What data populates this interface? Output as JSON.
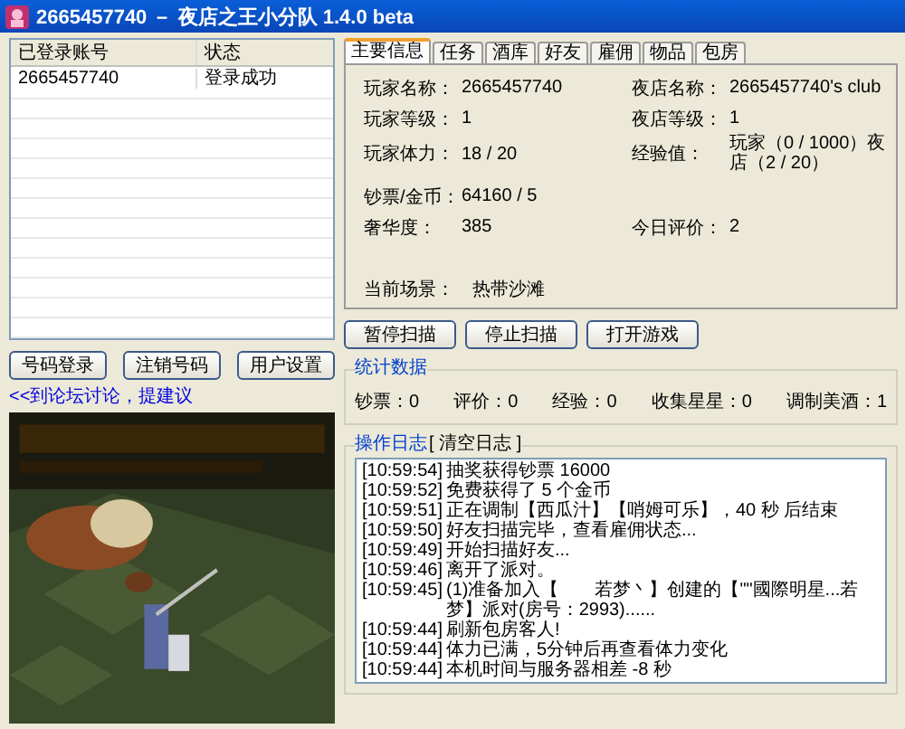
{
  "window": {
    "title": "2665457740 － 夜店之王小分队 1.4.0 beta"
  },
  "accounts": {
    "columns": [
      "已登录账号",
      "状态"
    ],
    "rows": [
      [
        "2665457740",
        "登录成功"
      ]
    ]
  },
  "left_buttons": [
    "号码登录",
    "注销号码",
    "用户设置"
  ],
  "forum_link": "<<到论坛讨论，提建议",
  "tabs": [
    {
      "label": "主要信息",
      "selected": true
    },
    {
      "label": "任务",
      "selected": false
    },
    {
      "label": "酒库",
      "selected": false
    },
    {
      "label": "好友",
      "selected": false
    },
    {
      "label": "雇佣",
      "selected": false
    },
    {
      "label": "物品",
      "selected": false
    },
    {
      "label": "包房",
      "selected": false
    }
  ],
  "info": [
    {
      "label": "玩家名称：",
      "value": "2665457740",
      "label2": "夜店名称：",
      "value2": "2665457740's club"
    },
    {
      "label": "玩家等级：",
      "value": "1",
      "label2": "夜店等级：",
      "value2": "1"
    },
    {
      "label": "玩家体力：",
      "value": "18 / 20",
      "label2": "经验值：",
      "value2": "玩家（0 / 1000）夜店（2 / 20）"
    },
    {
      "label": "钞票/金币：",
      "value": "64160 / 5"
    },
    {
      "label": "奢华度：",
      "value": "385",
      "label2": "今日评价：",
      "value2": "2"
    }
  ],
  "scene": {
    "label": "当前场景：",
    "value": "热带沙滩"
  },
  "right_buttons": [
    "暂停扫描",
    "停止扫描",
    "打开游戏"
  ],
  "stats": {
    "title": "统计数据",
    "items": [
      "钞票：0",
      "评价：0",
      "经验：0",
      "收集星星：0",
      "调制美酒：1"
    ]
  },
  "log": {
    "title": "操作日志",
    "clear": "[ 清空日志 ]",
    "entries": [
      {
        "time": "[10:59:54]",
        "text": "抽奖获得钞票 16000"
      },
      {
        "time": "[10:59:52]",
        "text": "免费获得了 5 个金币"
      },
      {
        "time": "[10:59:51]",
        "text": "正在调制【西瓜汁】【哨姆可乐】，40 秒 后结束"
      },
      {
        "time": "[10:59:50]",
        "text": "好友扫描完毕，查看雇佣状态..."
      },
      {
        "time": "[10:59:49]",
        "text": "开始扫描好友..."
      },
      {
        "time": "[10:59:46]",
        "text": "离开了派对。"
      },
      {
        "time": "[10:59:45]",
        "text": "(1)准备加入【　　若梦丶】创建的【\"\"國際明星...若梦】派对(房号：2993)......"
      },
      {
        "time": "[10:59:44]",
        "text": "刷新包房客人!"
      },
      {
        "time": "[10:59:44]",
        "text": "体力已满，5分钟后再查看体力变化"
      },
      {
        "time": "[10:59:44]",
        "text": "本机时间与服务器相差 -8 秒"
      }
    ]
  }
}
